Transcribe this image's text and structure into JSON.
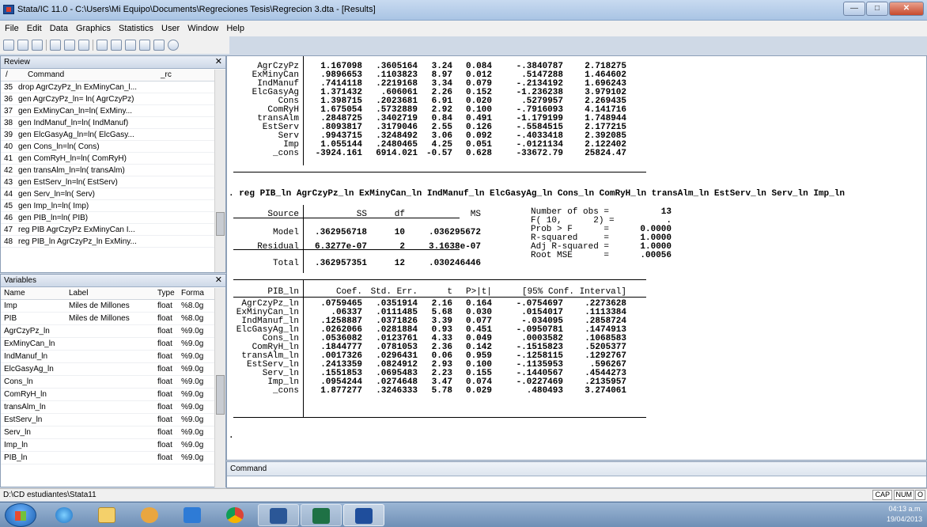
{
  "window": {
    "title": "Stata/IC 11.0 - C:\\Users\\Mi Equipo\\Documents\\Regreciones Tesis\\Regrecion 3.dta - [Results]"
  },
  "menu": [
    "File",
    "Edit",
    "Data",
    "Graphics",
    "Statistics",
    "User",
    "Window",
    "Help"
  ],
  "review": {
    "title": "Review",
    "col_slash": "/",
    "col_command": "Command",
    "col_rc": "_rc",
    "rows": [
      {
        "n": "35",
        "cmd": "drop AgrCzyPz_ln ExMinyCan_l..."
      },
      {
        "n": "36",
        "cmd": "gen AgrCzyPz_ln= ln( AgrCzyPz)"
      },
      {
        "n": "37",
        "cmd": "gen ExMinyCan_ln=ln( ExMiny..."
      },
      {
        "n": "38",
        "cmd": "gen IndManuf_ln=ln( IndManuf)"
      },
      {
        "n": "39",
        "cmd": "gen ElcGasyAg_ln=ln( ElcGasy..."
      },
      {
        "n": "40",
        "cmd": "gen Cons_ln=ln( Cons)"
      },
      {
        "n": "41",
        "cmd": "gen ComRyH_ln=ln( ComRyH)"
      },
      {
        "n": "42",
        "cmd": "gen transAlm_ln=ln( transAlm)"
      },
      {
        "n": "43",
        "cmd": "gen EstServ_ln=ln( EstServ)"
      },
      {
        "n": "44",
        "cmd": "gen Serv_ln=ln( Serv)"
      },
      {
        "n": "45",
        "cmd": "gen Imp_ln=ln( Imp)"
      },
      {
        "n": "46",
        "cmd": "gen PIB_ln=ln( PIB)"
      },
      {
        "n": "47",
        "cmd": "reg PIB AgrCzyPz ExMinyCan I..."
      },
      {
        "n": "48",
        "cmd": "reg PIB_ln AgrCzyPz_ln ExMiny..."
      }
    ]
  },
  "variables": {
    "title": "Variables",
    "col_name": "Name",
    "col_label": "Label",
    "col_type": "Type",
    "col_format": "Forma",
    "rows": [
      {
        "name": "Imp",
        "label": "Miles de Millones",
        "type": "float",
        "format": "%8.0g"
      },
      {
        "name": "PIB",
        "label": "Miles de Millones",
        "type": "float",
        "format": "%8.0g"
      },
      {
        "name": "AgrCzyPz_ln",
        "label": "",
        "type": "float",
        "format": "%9.0g"
      },
      {
        "name": "ExMinyCan_ln",
        "label": "",
        "type": "float",
        "format": "%9.0g"
      },
      {
        "name": "IndManuf_ln",
        "label": "",
        "type": "float",
        "format": "%9.0g"
      },
      {
        "name": "ElcGasyAg_ln",
        "label": "",
        "type": "float",
        "format": "%9.0g"
      },
      {
        "name": "Cons_ln",
        "label": "",
        "type": "float",
        "format": "%9.0g"
      },
      {
        "name": "ComRyH_ln",
        "label": "",
        "type": "float",
        "format": "%9.0g"
      },
      {
        "name": "transAlm_ln",
        "label": "",
        "type": "float",
        "format": "%9.0g"
      },
      {
        "name": "EstServ_ln",
        "label": "",
        "type": "float",
        "format": "%9.0g"
      },
      {
        "name": "Serv_ln",
        "label": "",
        "type": "float",
        "format": "%9.0g"
      },
      {
        "name": "Imp_ln",
        "label": "",
        "type": "float",
        "format": "%9.0g"
      },
      {
        "name": "PIB_ln",
        "label": "",
        "type": "float",
        "format": "%9.0g"
      }
    ]
  },
  "results": {
    "top_rows": [
      [
        "AgrCzyPz",
        "1.167098",
        ".3605164",
        "3.24",
        "0.084",
        "-.3840787",
        "2.718275"
      ],
      [
        "ExMinyCan",
        ".9896653",
        ".1103823",
        "8.97",
        "0.012",
        ".5147288",
        "1.464602"
      ],
      [
        "IndManuf",
        ".7414118",
        ".2219168",
        "3.34",
        "0.079",
        "-.2134192",
        "1.696243"
      ],
      [
        "ElcGasyAg",
        "1.371432",
        ".606061",
        "2.26",
        "0.152",
        "-1.236238",
        "3.979102"
      ],
      [
        "Cons",
        "1.398715",
        ".2023681",
        "6.91",
        "0.020",
        ".5279957",
        "2.269435"
      ],
      [
        "ComRyH",
        "1.675054",
        ".5732889",
        "2.92",
        "0.100",
        "-.7916093",
        "4.141716"
      ],
      [
        "transAlm",
        ".2848725",
        ".3402719",
        "0.84",
        "0.491",
        "-1.179199",
        "1.748944"
      ],
      [
        "EstServ",
        ".8093817",
        ".3179046",
        "2.55",
        "0.126",
        "-.5584515",
        "2.177215"
      ],
      [
        "Serv",
        ".9943715",
        ".3248492",
        "3.06",
        "0.092",
        "-.4033418",
        "2.392085"
      ],
      [
        "Imp",
        "1.055144",
        ".2480465",
        "4.25",
        "0.051",
        "-.0121134",
        "2.122402"
      ],
      [
        "_cons",
        "-3924.161",
        "6914.021",
        "-0.57",
        "0.628",
        "-33672.79",
        "25824.47"
      ]
    ],
    "command": ". reg PIB_ln AgrCzyPz_ln ExMinyCan_ln IndManuf_ln ElcGasyAg_ln Cons_ln ComRyH_ln transAlm_ln EstServ_ln Serv_ln Imp_ln",
    "anova_head": [
      "Source",
      "SS",
      "df",
      "MS"
    ],
    "anova_rows": [
      [
        "Model",
        ".362956718",
        "10",
        ".036295672"
      ],
      [
        "Residual",
        "6.3277e-07",
        "2",
        "3.1638e-07"
      ],
      [
        "Total",
        ".362957351",
        "12",
        ".030246446"
      ]
    ],
    "stats": [
      {
        "label": "Number of obs =",
        "value": "13"
      },
      {
        "label": "F( 10,      2) =",
        "value": "."
      },
      {
        "label": "Prob > F      =",
        "value": "0.0000"
      },
      {
        "label": "R-squared     =",
        "value": "1.0000"
      },
      {
        "label": "Adj R-squared =",
        "value": "1.0000"
      },
      {
        "label": "Root MSE      =",
        "value": ".00056"
      }
    ],
    "coef_head": [
      "PIB_ln",
      "Coef.",
      "Std. Err.",
      "t",
      "P>|t|",
      "[95% Conf. Interval]"
    ],
    "coef_rows": [
      [
        "AgrCzyPz_ln",
        ".0759465",
        ".0351914",
        "2.16",
        "0.164",
        "-.0754697",
        ".2273628"
      ],
      [
        "ExMinyCan_ln",
        ".06337",
        ".0111485",
        "5.68",
        "0.030",
        ".0154017",
        ".1113384"
      ],
      [
        "IndManuf_ln",
        ".1258887",
        ".0371826",
        "3.39",
        "0.077",
        "-.034095",
        ".2858724"
      ],
      [
        "ElcGasyAg_ln",
        ".0262066",
        ".0281884",
        "0.93",
        "0.451",
        "-.0950781",
        ".1474913"
      ],
      [
        "Cons_ln",
        ".0536082",
        ".0123761",
        "4.33",
        "0.049",
        ".0003582",
        ".1068583"
      ],
      [
        "ComRyH_ln",
        ".1844777",
        ".0781053",
        "2.36",
        "0.142",
        "-.1515823",
        ".5205377"
      ],
      [
        "transAlm_ln",
        ".0017326",
        ".0296431",
        "0.06",
        "0.959",
        "-.1258115",
        ".1292767"
      ],
      [
        "EstServ_ln",
        ".2413359",
        ".0824912",
        "2.93",
        "0.100",
        "-.1135953",
        ".596267"
      ],
      [
        "Serv_ln",
        ".1551853",
        ".0695483",
        "2.23",
        "0.155",
        "-.1440567",
        ".4544273"
      ],
      [
        "Imp_ln",
        ".0954244",
        ".0274648",
        "3.47",
        "0.074",
        "-.0227469",
        ".2135957"
      ],
      [
        "_cons",
        "1.877277",
        ".3246333",
        "5.78",
        "0.029",
        ".480493",
        "3.274061"
      ]
    ],
    "prompt": "."
  },
  "command_panel": {
    "title": "Command"
  },
  "status": {
    "path": "D:\\CD estudiantes\\Stata11",
    "cap": "CAP",
    "num": "NUM",
    "ovr": "O"
  },
  "taskbar": {
    "time": "04:13 a.m.",
    "date": "19/04/2013"
  }
}
